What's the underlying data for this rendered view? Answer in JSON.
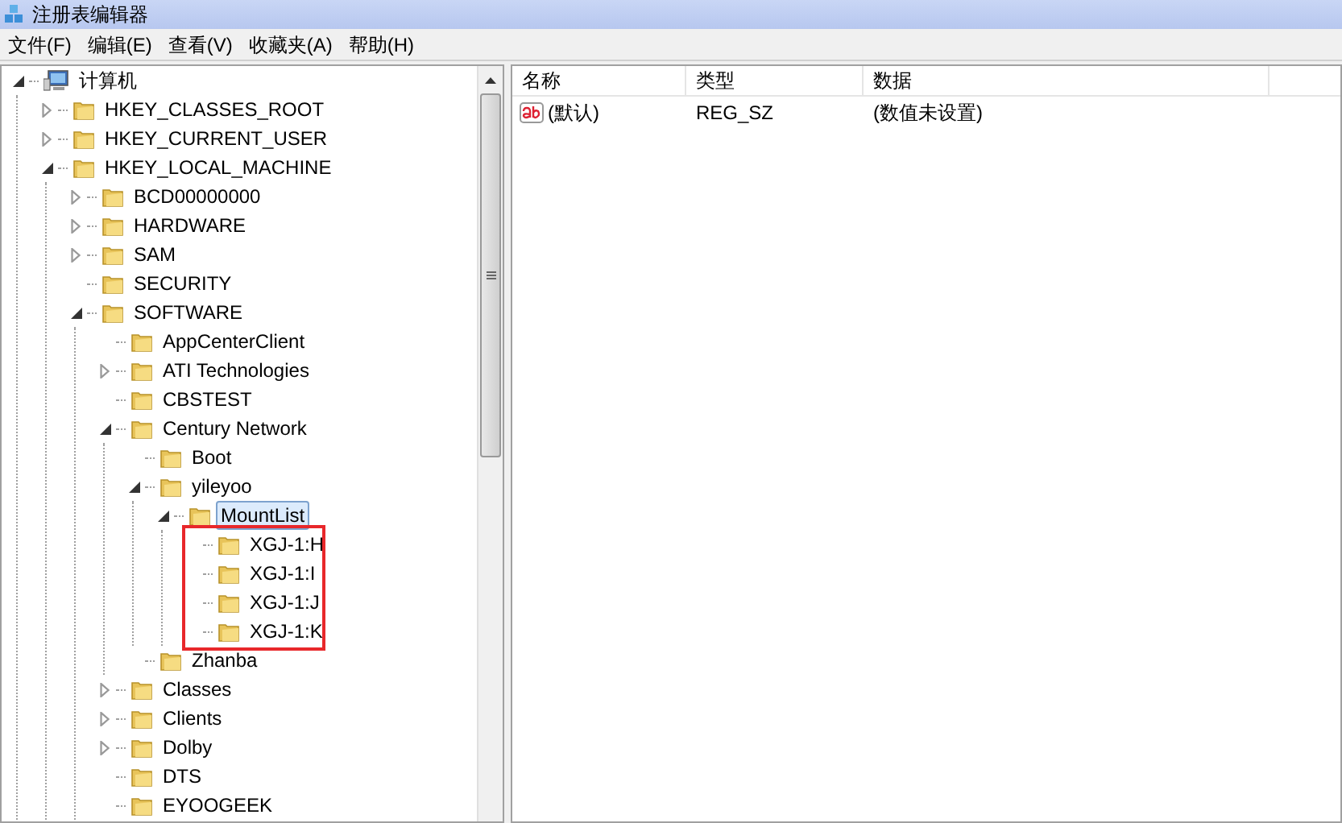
{
  "window": {
    "title": "注册表编辑器"
  },
  "menu": [
    "文件(F)",
    "编辑(E)",
    "查看(V)",
    "收藏夹(A)",
    "帮助(H)"
  ],
  "tree": [
    {
      "label": "计算机",
      "kind": "computer",
      "expandable": true,
      "expanded": true,
      "selected": false,
      "children": [
        {
          "label": "HKEY_CLASSES_ROOT",
          "kind": "folder",
          "expandable": true,
          "expanded": false,
          "selected": false
        },
        {
          "label": "HKEY_CURRENT_USER",
          "kind": "folder",
          "expandable": true,
          "expanded": false,
          "selected": false
        },
        {
          "label": "HKEY_LOCAL_MACHINE",
          "kind": "folder",
          "expandable": true,
          "expanded": true,
          "selected": false,
          "children": [
            {
              "label": "BCD00000000",
              "kind": "folder",
              "expandable": true,
              "expanded": false,
              "selected": false
            },
            {
              "label": "HARDWARE",
              "kind": "folder",
              "expandable": true,
              "expanded": false,
              "selected": false
            },
            {
              "label": "SAM",
              "kind": "folder",
              "expandable": true,
              "expanded": false,
              "selected": false
            },
            {
              "label": "SECURITY",
              "kind": "folder",
              "expandable": false,
              "selected": false
            },
            {
              "label": "SOFTWARE",
              "kind": "folder",
              "expandable": true,
              "expanded": true,
              "selected": false,
              "children": [
                {
                  "label": "AppCenterClient",
                  "kind": "folder",
                  "expandable": false,
                  "selected": false
                },
                {
                  "label": "ATI Technologies",
                  "kind": "folder",
                  "expandable": true,
                  "expanded": false,
                  "selected": false
                },
                {
                  "label": "CBSTEST",
                  "kind": "folder",
                  "expandable": false,
                  "selected": false
                },
                {
                  "label": "Century Network",
                  "kind": "folder",
                  "expandable": true,
                  "expanded": true,
                  "selected": false,
                  "children": [
                    {
                      "label": "Boot",
                      "kind": "folder",
                      "expandable": false,
                      "selected": false
                    },
                    {
                      "label": "yileyoo",
                      "kind": "folder",
                      "expandable": true,
                      "expanded": true,
                      "selected": false,
                      "children": [
                        {
                          "label": "MountList",
                          "kind": "folder",
                          "expandable": true,
                          "expanded": true,
                          "selected": true,
                          "framed_children": true,
                          "children": [
                            {
                              "label": "XGJ-1:H",
                              "kind": "folder",
                              "expandable": false,
                              "selected": false
                            },
                            {
                              "label": "XGJ-1:I",
                              "kind": "folder",
                              "expandable": false,
                              "selected": false
                            },
                            {
                              "label": "XGJ-1:J",
                              "kind": "folder",
                              "expandable": false,
                              "selected": false
                            },
                            {
                              "label": "XGJ-1:K",
                              "kind": "folder",
                              "expandable": false,
                              "selected": false
                            }
                          ]
                        }
                      ]
                    },
                    {
                      "label": "Zhanba",
                      "kind": "folder",
                      "expandable": false,
                      "selected": false
                    }
                  ]
                },
                {
                  "label": "Classes",
                  "kind": "folder",
                  "expandable": true,
                  "expanded": false,
                  "selected": false
                },
                {
                  "label": "Clients",
                  "kind": "folder",
                  "expandable": true,
                  "expanded": false,
                  "selected": false
                },
                {
                  "label": "Dolby",
                  "kind": "folder",
                  "expandable": true,
                  "expanded": false,
                  "selected": false
                },
                {
                  "label": "DTS",
                  "kind": "folder",
                  "expandable": false,
                  "selected": false
                },
                {
                  "label": "EYOOGEEK",
                  "kind": "folder",
                  "expandable": false,
                  "selected": false
                }
              ]
            }
          ]
        }
      ]
    }
  ],
  "table": {
    "columns": [
      "名称",
      "类型",
      "数据"
    ],
    "rows": [
      {
        "kind": "string",
        "cells": [
          "(默认)",
          "REG_SZ",
          "(数值未设置)"
        ]
      }
    ]
  }
}
